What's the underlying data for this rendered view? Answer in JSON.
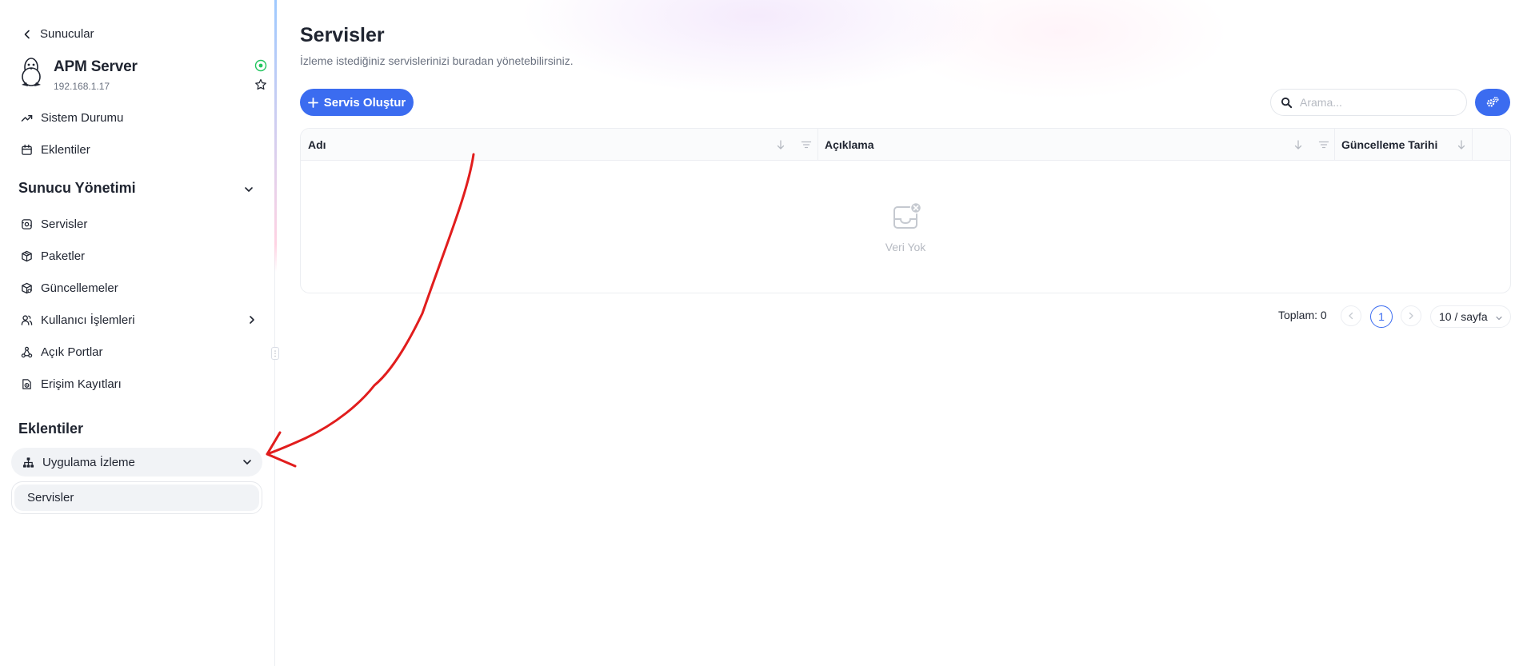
{
  "sidebar": {
    "back_label": "Sunucular",
    "server": {
      "name": "APM Server",
      "ip": "192.168.1.17",
      "status_color": "#22c55e"
    },
    "nav_top": [
      {
        "label": "Sistem Durumu",
        "icon": "trending-up-icon"
      },
      {
        "label": "Eklentiler",
        "icon": "calendar-icon"
      }
    ],
    "section_management": {
      "title": "Sunucu Yönetimi"
    },
    "nav_management": [
      {
        "label": "Servisler",
        "icon": "service-icon"
      },
      {
        "label": "Paketler",
        "icon": "package-icon"
      },
      {
        "label": "Güncellemeler",
        "icon": "update-box-icon"
      },
      {
        "label": "Kullanıcı İşlemleri",
        "icon": "users-icon"
      },
      {
        "label": "Açık Portlar",
        "icon": "network-icon"
      },
      {
        "label": "Erişim Kayıtları",
        "icon": "access-log-icon"
      }
    ],
    "section_plugins": {
      "title": "Eklentiler"
    },
    "plugin_group": {
      "label": "Uygulama İzleme",
      "icon": "sitemap-icon"
    },
    "plugin_subitems": [
      {
        "label": "Servisler"
      }
    ]
  },
  "main": {
    "title": "Servisler",
    "subtitle": "İzleme istediğiniz servislerinizi buradan yönetebilirsiniz.",
    "create_button": "Servis Oluştur",
    "search": {
      "placeholder": "Arama...",
      "value": ""
    },
    "table": {
      "columns": [
        {
          "label": "Adı"
        },
        {
          "label": "Açıklama"
        },
        {
          "label": "Güncelleme Tarihi"
        }
      ],
      "rows": [],
      "empty_text": "Veri Yok"
    },
    "pagination": {
      "total_label": "Toplam: 0",
      "current_page": "1",
      "page_size": "10 / sayfa"
    }
  },
  "colors": {
    "primary": "#3b6cf0",
    "annotation": "#e11d1d"
  }
}
